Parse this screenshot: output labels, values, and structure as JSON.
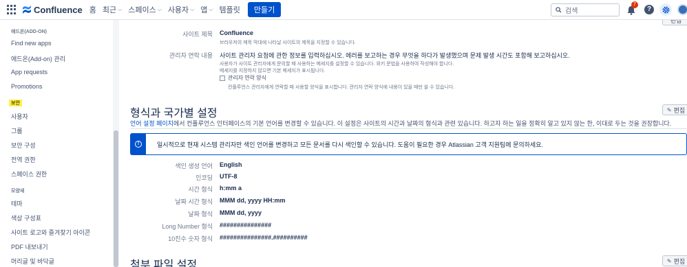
{
  "nav": {
    "logo": "Confluence",
    "items": [
      "홈",
      "최근",
      "스페이스",
      "사용자",
      "앱",
      "템플릿"
    ],
    "create": "만들기",
    "search_placeholder": "검색",
    "notification_count": "7"
  },
  "sidebar": {
    "section_addon": "애드온(ADD-ON)",
    "addon_items": [
      "Find new apps",
      "애드온(Add-on) 관리",
      "App requests",
      "Promotions"
    ],
    "section_security": "보안",
    "security_items": [
      "사용자",
      "그룹",
      "보안 구성",
      "전역 권한",
      "스페이스 권한"
    ],
    "section_lookfeel": "모양새",
    "lookfeel_items": [
      "테마",
      "색상 구성표",
      "사이트 로고와 즐겨찾기 아이콘",
      "PDF 내보내기",
      "머리글 및 바닥글"
    ]
  },
  "site_config": {
    "site_title_label": "사이트 제목",
    "site_title_value": "Confluence",
    "site_title_desc": "브라우저의 제목 막대에 나타날 사이트의 제목을 지정할 수 있습니다.",
    "admin_contact_label": "관리자 연락 내용",
    "admin_contact_value": "사이트 관리자 요청에 관한 정보를 입력하십시오. 에러를 보고하는 경우 무엇을 하다가 발생했으며 문제 발생 시간도 포함해 보고하십시오.",
    "admin_contact_desc1": "사용자가 사이트 관리자에게 문의할 때 사용하는 메세지를 설정할 수 있습니다. 위키 문법을 사용하여 작성해야 합니다.",
    "admin_contact_desc2": "메세지를 지정하지 않으면 기본 메세지가 표시됩니다.",
    "admin_form_checkbox": "관리자 연락 양식",
    "admin_form_desc": "컨플루언스 관리자에게 연락할 때 사용할 양식을 표시합니다. 관리자 연락 양식에 내용이 있을 때만 쓸 수 있습니다."
  },
  "format_section": {
    "title": "형식과 국가별 설정",
    "edit": "편집",
    "intro_link": "언어 설정 페이지",
    "intro_rest": "에서 컨플루언스 인터페이스의 기본 언어를 변경할 수 있습니다. 이 설정은 사이트의 시간과 날짜의 형식과 관련 있습니다. 하고자 하는 일을 정확히 알고 있지 않는 한, 이대로 두는 것을 권장합니다.",
    "info": "일시적으로 현재 시스템 관리자만 색인 언어를 변경하고 모든 문서를 다시 색인할 수 있습니다. 도움이 필요한 경우 Atlassian 고객 지원팀에 문의하세요.",
    "rows": [
      {
        "label": "색인 생성 언어",
        "value": "English"
      },
      {
        "label": "인코딩",
        "value": "UTF-8"
      },
      {
        "label": "시간 형식",
        "value": "h:mm a"
      },
      {
        "label": "날짜 시간 형식",
        "value": "MMM dd, yyyy HH:mm"
      },
      {
        "label": "날짜 형식",
        "value": "MMM dd, yyyy"
      },
      {
        "label": "Long Number 형식",
        "value": "###############"
      },
      {
        "label": "10진수 숫자 형식",
        "value": "###############.##########"
      }
    ]
  },
  "attachment_section": {
    "title": "첨부 파일 설정",
    "edit": "편집"
  },
  "top_edit": "편집"
}
